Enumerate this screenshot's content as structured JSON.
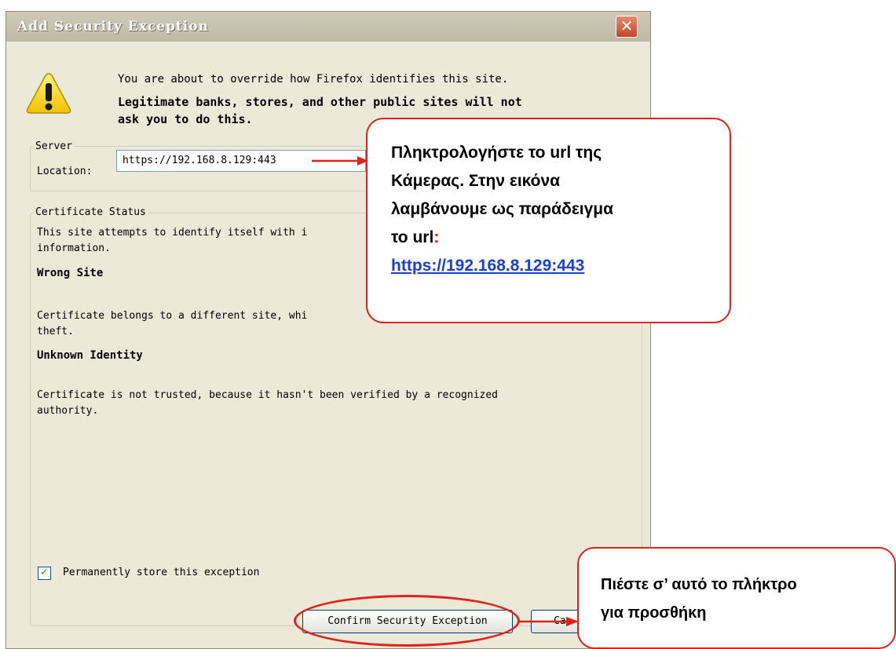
{
  "dialog": {
    "title": "Add Security Exception",
    "close_label": "✕",
    "warning_line1": "You are about to override how Firefox identifies this site.",
    "warning_bold1": "Legitimate banks, stores, and other public sites will not",
    "warning_bold2": "ask you to do this.",
    "server": {
      "legend": "Server",
      "location_label": "Location:",
      "location_value": "https://192.168.8.129:443"
    },
    "status": {
      "legend": "Certificate Status",
      "intro1": "This site attempts to identify itself with i",
      "intro2": "information.",
      "wrong_site_heading": "Wrong Site",
      "wrong_site_text1": "Certificate belongs to a different site, whi",
      "wrong_site_text2": "theft.",
      "unknown_heading": "Unknown Identity",
      "unknown_text1": "Certificate is not trusted, because it hasn't been verified by a recognized",
      "unknown_text2": "authority."
    },
    "permanent_checkbox_label": "Permanently store this exception",
    "permanent_checked": true,
    "confirm_button": "Confirm Security Exception",
    "cancel_button_partial": "Ca"
  },
  "annotations": {
    "callout1": {
      "line1": "Πληκτρολογήστε το url της",
      "line2": "Κάμερας. Στην εικόνα",
      "line3": "λαμβάνουμε ως παράδειγμα",
      "line4_text": "το url",
      "line4_colon": ":",
      "url": "https://192.168.8.129:443"
    },
    "callout2": {
      "line1": "Πιέστε σ’ αυτό το πλήκτρο",
      "line2": "για προσθήκη"
    }
  },
  "colors": {
    "accent_red": "#e0221b",
    "link_blue": "#1a3fd6",
    "dialog_bg": "#ece9d8"
  },
  "icons": {
    "warning": "warning-triangle-icon",
    "close": "close-icon",
    "check": "checkmark-icon"
  }
}
